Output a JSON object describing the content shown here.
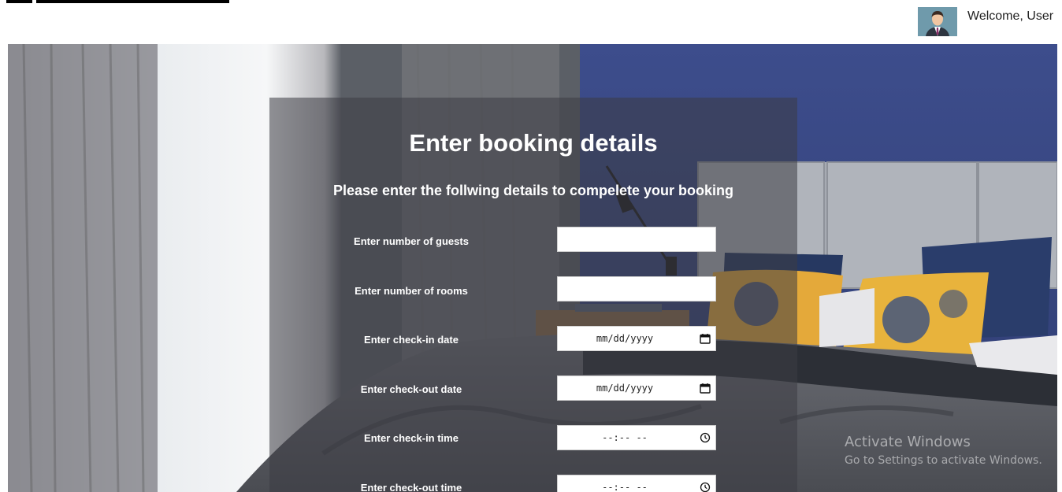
{
  "header": {
    "welcome_text": "Welcome, User"
  },
  "form": {
    "title": "Enter booking details",
    "subtitle": "Please enter the follwing details to compelete your booking",
    "fields": [
      {
        "label": "Enter number of guests",
        "placeholder": ""
      },
      {
        "label": "Enter number of rooms",
        "placeholder": ""
      },
      {
        "label": "Enter check-in date",
        "placeholder": "mm/dd/yyyy"
      },
      {
        "label": "Enter check-out date",
        "placeholder": "mm/dd/yyyy"
      },
      {
        "label": "Enter check-in time",
        "placeholder": "--:-- --"
      },
      {
        "label": "Enter check-out time",
        "placeholder": "--:-- --"
      }
    ]
  },
  "watermark": {
    "line1": "Activate Windows",
    "line2": "Go to Settings to activate Windows."
  },
  "icons": {
    "date_field": "calendar-icon",
    "time_field": "clock-icon",
    "avatar": "user-avatar"
  }
}
